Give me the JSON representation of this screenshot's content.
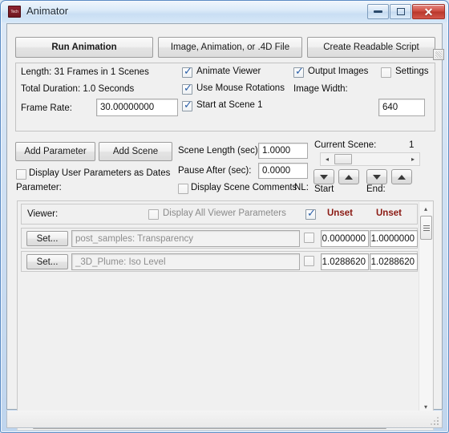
{
  "window": {
    "title": "Animator",
    "icon": "tech-app-icon",
    "icon_text": "Tech",
    "controls": {
      "minimize": "minimize-icon",
      "maximize": "maximize-icon",
      "close": "✕",
      "close_color": "#bc3b2e"
    }
  },
  "toolbar": {
    "run_animation": "Run Animation",
    "image_file": "Image, Animation, or .4D File",
    "create_script": "Create Readable Script",
    "tiny_toggle": "panel-toggle-icon"
  },
  "info": {
    "length": "Length: 31 Frames in 1 Scenes",
    "duration": "Total Duration: 1.0 Seconds",
    "frame_rate_label": "Frame Rate:",
    "frame_rate_value": "30.00000000"
  },
  "options": {
    "animate_viewer": {
      "label": "Animate Viewer",
      "checked": true
    },
    "use_mouse_rotations": {
      "label": "Use Mouse Rotations",
      "checked": true
    },
    "start_at_scene": {
      "label": "Start at Scene 1",
      "checked": true
    },
    "output_images": {
      "label": "Output Images",
      "checked": true
    },
    "settings": {
      "label": "Settings",
      "checked": false
    },
    "image_width_label": "Image Width:",
    "image_width_value": "640"
  },
  "actions": {
    "add_parameter": "Add Parameter",
    "add_scene": "Add Scene",
    "display_user_params_as_dates": {
      "label": "Display User Parameters as Dates",
      "checked": false
    },
    "parameter_label": "Parameter:"
  },
  "scene": {
    "scene_length_label": "Scene Length (sec):",
    "scene_length_value": "1.0000",
    "pause_after_label": "Pause After (sec):",
    "pause_after_value": "0.0000",
    "display_scene_comments": {
      "label": "Display Scene Comments",
      "checked": false
    },
    "nl_label": "NL:",
    "current_scene_label": "Current Scene:",
    "current_scene_value": "1",
    "scroll_left": "◂",
    "scroll_right": "▸",
    "start_label": "Start",
    "end_label": "End:"
  },
  "params_table": {
    "viewer_row": {
      "name": "Viewer:",
      "display_all_label": "Display All Viewer Parameters",
      "display_all_checked": false,
      "enabled_checked": true,
      "start_value": "Unset",
      "end_value": "Unset",
      "unset_color": "#8b1a13"
    },
    "set_button_label": "Set...",
    "rows": [
      {
        "set_label": "Set...",
        "name": "post_samples: Transparency",
        "enabled": false,
        "start_value": "0.0000000",
        "end_value": "1.0000000"
      },
      {
        "set_label": "Set...",
        "name": "_3D_Plume: Iso Level",
        "enabled": false,
        "start_value": "1.0288620",
        "end_value": "1.0288620"
      }
    ]
  },
  "scrollbars": {
    "v_up": "▴",
    "v_down": "▾",
    "h_left": "◂",
    "h_right": "▸"
  }
}
